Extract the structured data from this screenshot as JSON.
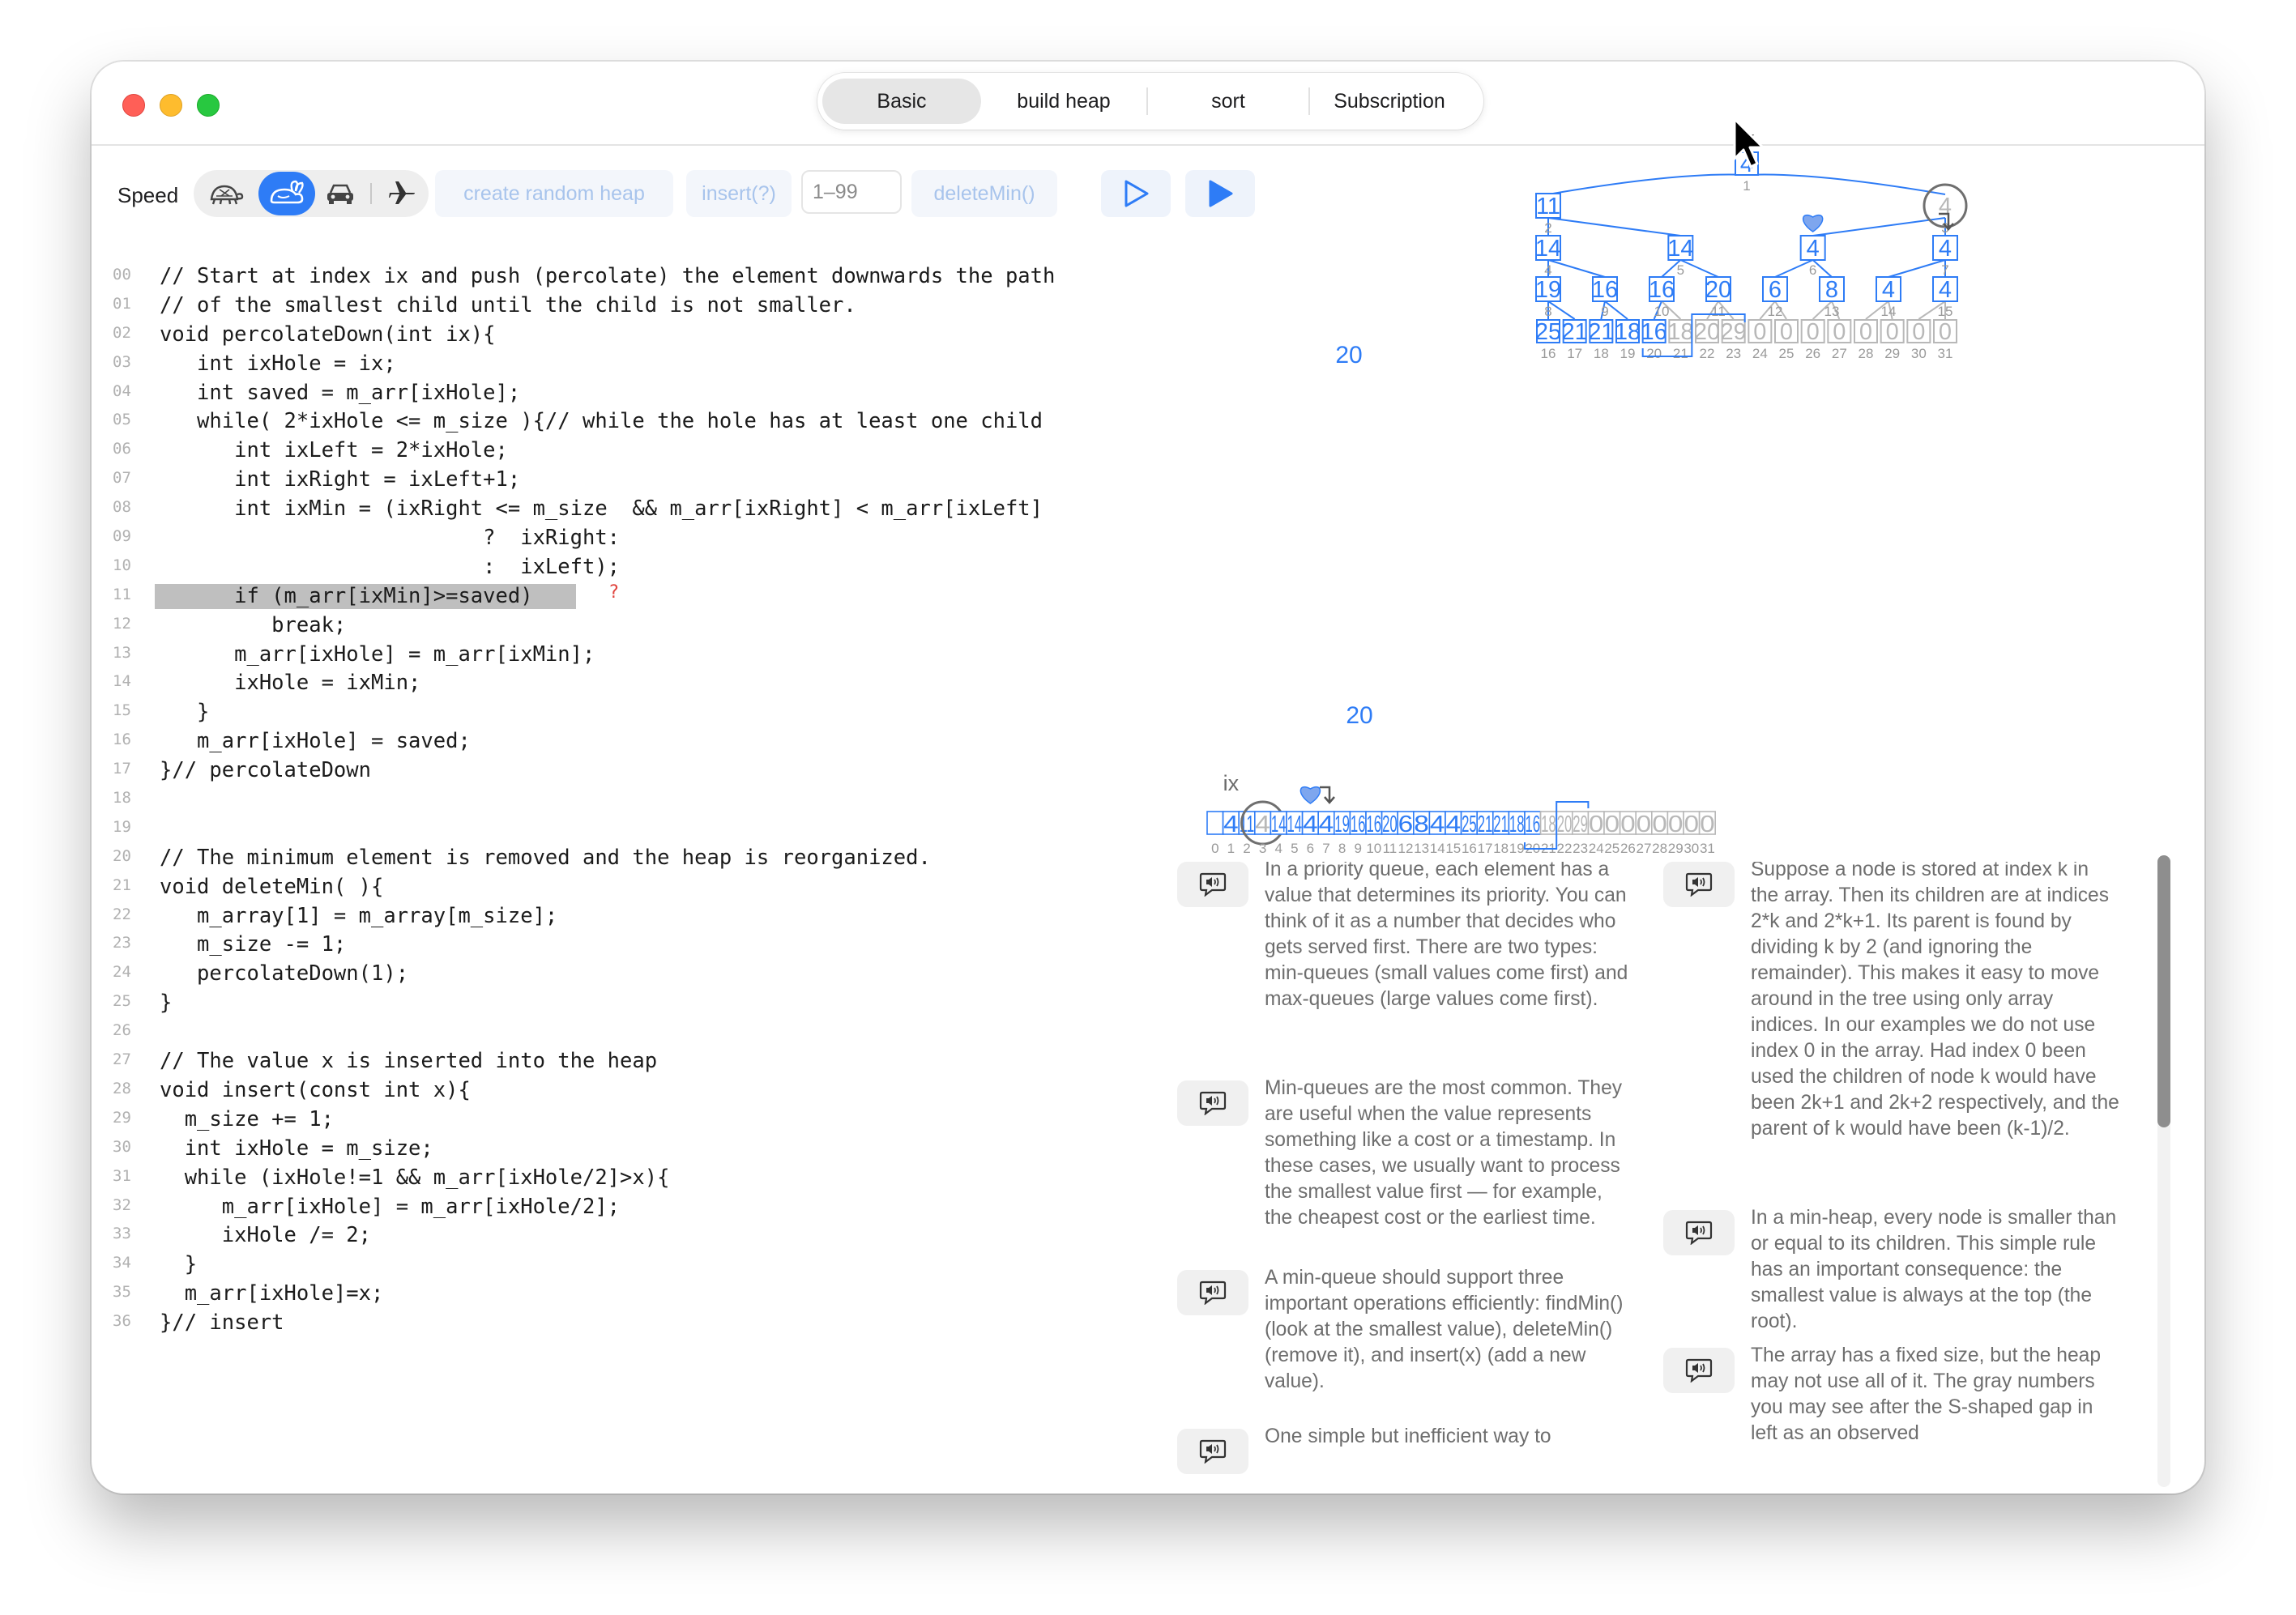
{
  "tabs": [
    "Basic",
    "build heap",
    "sort",
    "Subscription"
  ],
  "active_tab": "Basic",
  "toolbar": {
    "speed_label": "Speed",
    "speed_icons": [
      "turtle-icon",
      "rabbit-icon",
      "car-icon",
      "airplane-icon"
    ],
    "active_speed": "rabbit-icon",
    "create_random_heap": "create random heap",
    "insert": "insert(?)",
    "insert_placeholder": "1–99",
    "delete_min": "deleteMin()",
    "step_icon": "play-outline-icon",
    "run_icon": "play-filled-icon"
  },
  "code": [
    {
      "n": "00",
      "t": "// Start at index ix and push (percolate) the element downwards the path"
    },
    {
      "n": "01",
      "t": "// of the smallest child until the child is not smaller."
    },
    {
      "n": "02",
      "t": "void percolateDown(int ix){"
    },
    {
      "n": "03",
      "t": "   int ixHole = ix;"
    },
    {
      "n": "04",
      "t": "   int saved = m_arr[ixHole];"
    },
    {
      "n": "05",
      "t": "   while( 2*ixHole <= m_size ){// while the hole has at least one child"
    },
    {
      "n": "06",
      "t": "      int ixLeft = 2*ixHole;"
    },
    {
      "n": "07",
      "t": "      int ixRight = ixLeft+1;"
    },
    {
      "n": "08",
      "t": "      int ixMin = (ixRight <= m_size  && m_arr[ixRight] < m_arr[ixLeft]"
    },
    {
      "n": "09",
      "t": "                          ?  ixRight:"
    },
    {
      "n": "10",
      "t": "                          :  ixLeft);"
    },
    {
      "n": "11",
      "t": "      if (m_arr[ixMin]>=saved)",
      "highlight": true,
      "mark": "?"
    },
    {
      "n": "12",
      "t": "         break;"
    },
    {
      "n": "13",
      "t": "      m_arr[ixHole] = m_arr[ixMin];"
    },
    {
      "n": "14",
      "t": "      ixHole = ixMin;"
    },
    {
      "n": "15",
      "t": "   }"
    },
    {
      "n": "16",
      "t": "   m_arr[ixHole] = saved;"
    },
    {
      "n": "17",
      "t": "}// percolateDown"
    },
    {
      "n": "18",
      "t": ""
    },
    {
      "n": "19",
      "t": ""
    },
    {
      "n": "20",
      "t": "// The minimum element is removed and the heap is reorganized."
    },
    {
      "n": "21",
      "t": "void deleteMin( ){"
    },
    {
      "n": "22",
      "t": "   m_array[1] = m_array[m_size];"
    },
    {
      "n": "23",
      "t": "   m_size -= 1;"
    },
    {
      "n": "24",
      "t": "   percolateDown(1);"
    },
    {
      "n": "25",
      "t": "}"
    },
    {
      "n": "26",
      "t": ""
    },
    {
      "n": "27",
      "t": "// The value x is inserted into the heap"
    },
    {
      "n": "28",
      "t": "void insert(const int x){"
    },
    {
      "n": "29",
      "t": "  m_size += 1;"
    },
    {
      "n": "30",
      "t": "  int ixHole = m_size;"
    },
    {
      "n": "31",
      "t": "  while (ixHole!=1 && m_arr[ixHole/2]>x){"
    },
    {
      "n": "32",
      "t": "     m_arr[ixHole] = m_arr[ixHole/2];"
    },
    {
      "n": "33",
      "t": "     ixHole /= 2;"
    },
    {
      "n": "34",
      "t": "  }"
    },
    {
      "n": "35",
      "t": "  m_arr[ixHole]=x;"
    },
    {
      "n": "36",
      "t": "}// insert"
    }
  ],
  "heap": {
    "size": "20",
    "ix_label": "ix",
    "values": [
      "",
      "4",
      "11",
      "4",
      "14",
      "14",
      "4",
      "4",
      "19",
      "16",
      "16",
      "20",
      "6",
      "8",
      "4",
      "4",
      "25",
      "21",
      "21",
      "18",
      "16",
      "18",
      "20",
      "29",
      "0",
      "0",
      "0",
      "0",
      "0",
      "0",
      "0",
      "0"
    ],
    "active_count": 21,
    "ix_index": 1,
    "hole_index": 3,
    "heart_index": 6,
    "arrow_index": 7,
    "colors": {
      "active": "#2e7cf6",
      "inactive": "#b8b8b8",
      "index": "#9a9a9a",
      "hole": "#6f6f6f"
    }
  },
  "paragraphs": {
    "left": [
      "In a priority queue, each element has a value that determines its priority. You can think of it as a number that decides who gets served first. There are two types: min-queues (small values come first) and max-queues (large values come first).",
      "Min-queues are the most common. They are useful when the value represents something like a cost or a timestamp. In these cases, we usually want to process the smallest value first — for example, the cheapest cost or the earliest time.",
      "A min-queue should support three important operations efficiently: findMin() (look at the smallest value), deleteMin() (remove it), and insert(x) (add a new value).",
      "One simple but inefficient way to"
    ],
    "right": [
      "Suppose a node is stored at index k in the array. Then its children are at indices 2*k and 2*k+1. Its parent is found by dividing k by 2 (and ignoring the remainder). This makes it easy to move around in the tree using only array indices. In our examples we do not use index 0 in the array. Had index 0 been used the children of node k would have been 2k+1 and 2k+2 respectively, and the parent of k would have been (k-1)/2.",
      "In a min-heap, every node is smaller than or equal to its children. This simple rule has an important consequence: the smallest value is always at the top (the root).",
      "The array has a fixed size, but the heap may not use all of it. The gray numbers you may see after the S-shaped gap in left as an observed"
    ]
  }
}
